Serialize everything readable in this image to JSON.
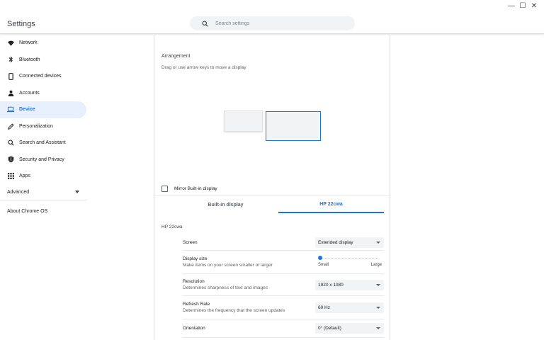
{
  "window": {
    "minimize_glyph": "—",
    "maximize_glyph": "☐",
    "close_glyph": "✕"
  },
  "header": {
    "title": "Settings",
    "search_placeholder": "Search settings",
    "search_value": ""
  },
  "sidebar": {
    "items": [
      {
        "label": "Network",
        "icon": "wifi-icon"
      },
      {
        "label": "Bluetooth",
        "icon": "bluetooth-icon"
      },
      {
        "label": "Connected devices",
        "icon": "phone-icon"
      },
      {
        "label": "Accounts",
        "icon": "person-icon"
      },
      {
        "label": "Device",
        "icon": "laptop-icon",
        "active": true
      },
      {
        "label": "Personalization",
        "icon": "pencil-icon"
      },
      {
        "label": "Search and Assistant",
        "icon": "search-icon"
      },
      {
        "label": "Security and Privacy",
        "icon": "shield-icon"
      },
      {
        "label": "Apps",
        "icon": "apps-grid-icon"
      }
    ],
    "advanced_label": "Advanced",
    "about_label": "About Chrome OS"
  },
  "arrangement": {
    "title": "Arrangement",
    "subtitle": "Drag or use arrow keys to move a display"
  },
  "mirror": {
    "label": "Mirror Built-in display",
    "checked": false
  },
  "tabs": [
    {
      "label": "Built-in display",
      "active": false
    },
    {
      "label": "HP 22cwa",
      "active": true
    }
  ],
  "device_name": "HP 22cwa",
  "settings": {
    "screen": {
      "label": "Screen",
      "value": "Extended display"
    },
    "display_size": {
      "label": "Display size",
      "sub": "Make items on your screen smaller or larger",
      "min_label": "Small",
      "max_label": "Large",
      "level": 0
    },
    "resolution": {
      "label": "Resolution",
      "sub": "Determines sharpness of text and images",
      "value": "1920 x 1080"
    },
    "refresh_rate": {
      "label": "Refresh Rate",
      "sub": "Determines the frequency that the screen updates",
      "value": "60 Hz"
    },
    "orientation": {
      "label": "Orientation",
      "value": "0° (Default)"
    }
  },
  "colors": {
    "accent": "#1a73e8",
    "active_bg": "#e8f0fe"
  }
}
